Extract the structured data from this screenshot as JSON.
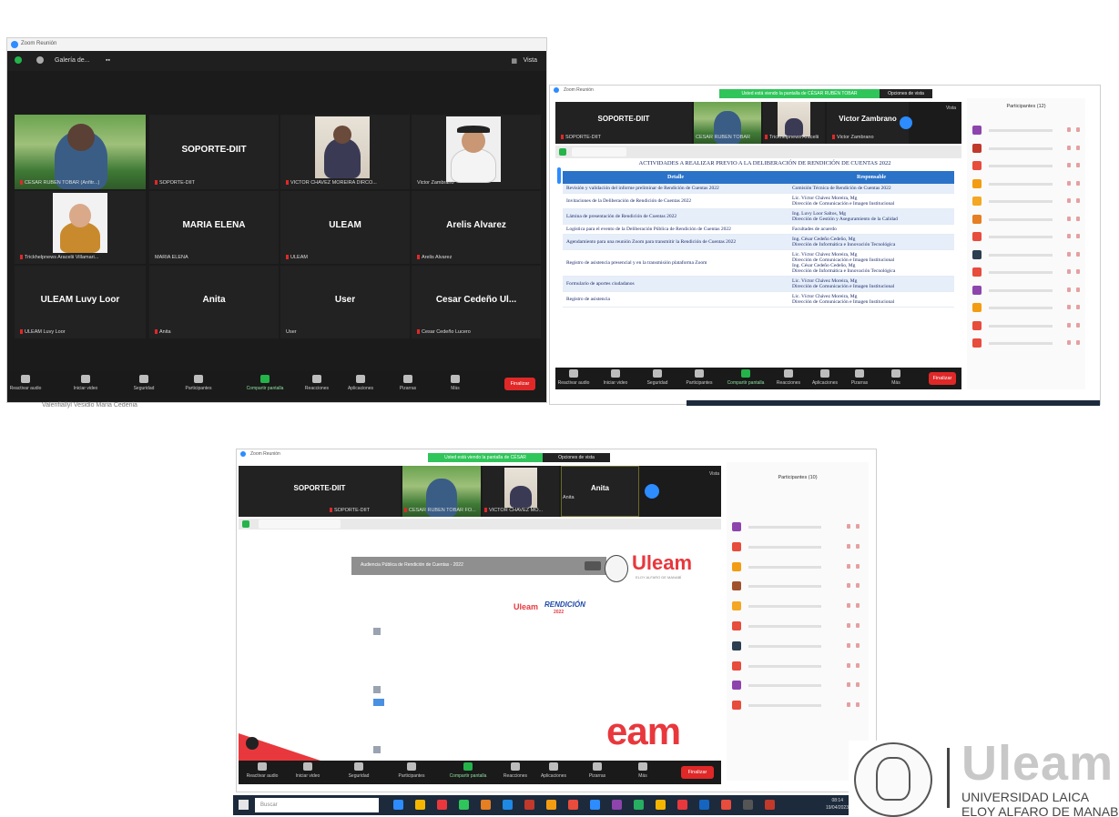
{
  "win1": {
    "title": "Zoom Reunión",
    "top_left_label": "Galería de...",
    "top_right_label": "Vista",
    "tiles": [
      {
        "name": "",
        "label": "CESAR RUBEN TOBAR (Anfitr...)"
      },
      {
        "name": "SOPORTE-DIIT",
        "label": "SOPORTE-DIIT"
      },
      {
        "name": "",
        "label": "VICTOR CHAVEZ MOREIRA DIRCO..."
      },
      {
        "name": "",
        "label": "Victor Zambrano"
      },
      {
        "name": "",
        "label": "Trickhelpnews Aracelii Villamari..."
      },
      {
        "name": "MARIA ELENA",
        "label": "MARIA ELENA"
      },
      {
        "name": "ULEAM",
        "label": "ULEAM"
      },
      {
        "name": "Arelis Alvarez",
        "label": "Arelis Alvarez"
      },
      {
        "name": "ULEAM Luvy Loor",
        "label": "ULEAM Luvy Loor"
      },
      {
        "name": "Anita",
        "label": "Anita"
      },
      {
        "name": "User",
        "label": "User"
      },
      {
        "name": "Cesar Cedeño Ul...",
        "label": "Cesar Cedeño Lucero"
      }
    ],
    "toolbar": [
      "Reactivar audio",
      "Iniciar video",
      "Seguridad",
      "Participantes",
      "Compartir pantalla",
      "Reacciones",
      "Aplicaciones",
      "Pizarras",
      "Más"
    ],
    "end_label": "Finalizar",
    "below_text": "Valenfiallyl Vesidlo Maria Cedenia"
  },
  "win2": {
    "title": "Zoom Reunión",
    "banner": "Usted está viendo la pantalla de CÉSAR RUBÉN TOBAR",
    "view_options": "Opciones de vista",
    "strip": [
      {
        "name": "SOPORTE-DIIT",
        "label": "SOPORTE-DIIT"
      },
      {
        "name": "",
        "label": "CESAR RUBEN TOBAR"
      },
      {
        "name": "",
        "label": "Trickhelpnews Aracelii"
      },
      {
        "name": "Victor Zambrano",
        "label": "Victor Zambrano"
      }
    ],
    "strip_view": "Vista",
    "doc_heading": "ACTIVIDADES A REALIZAR PREVIO A LA DELIBERACIÓN DE RENDICIÓN DE CUENTAS 2022",
    "table": {
      "headers": [
        "Detalle",
        "Responsable"
      ],
      "rows": [
        [
          "Revisión y validación del informe preliminar de Rendición de Cuentas 2022",
          "Comisión Técnica de Rendición de Cuentas 2022"
        ],
        [
          "Invitaciones de la Deliberación de Rendición de Cuentas 2022",
          "Lic. Víctor Chávez Moreira, Mg\nDirección de Comunicación e Imagen Institucional"
        ],
        [
          "Lámina de presentación de Rendición de Cuentas 2022",
          "Ing. Luvy Loor Saltos, Mg\nDirección de Gestión y Aseguramiento de la Calidad"
        ],
        [
          "Logística para el evento de la Deliberación Pública de Rendición de Cuentas 2022",
          "Facultades de acuerdo"
        ],
        [
          "Agendamiento para una reunión Zoom para transmitir la Rendición de Cuentas 2022",
          "Ing. César Cedeño Cedeño, Mg\nDirección de Informática e Innovación Tecnológica"
        ],
        [
          "Registro de asistencia presencial y en la transmisión plataforma Zoom",
          "Lic. Víctor Chávez Moreira, Mg\nDirección de Comunicación e Imagen Institucional\nIng. César Cedeño Cedeño, Mg\nDirección de Informática e Innovación Tecnológica"
        ],
        [
          "Formulario de aportes ciudadanos",
          "Lic. Víctor Chávez Moreira, Mg\nDirección de Comunicación e Imagen Institucional"
        ],
        [
          "Registro de asistencia",
          "Lic. Víctor Chávez Moreira, Mg\nDirección de Comunicación e Imagen Institucional"
        ]
      ]
    },
    "participants_title": "Participantes (12)",
    "toolbar": [
      "Reactivar audio",
      "Iniciar video",
      "Seguridad",
      "Participantes",
      "Compartir pantalla",
      "Reacciones",
      "Aplicaciones",
      "Pizarras",
      "Más"
    ],
    "end_label": "Finalizar"
  },
  "win3": {
    "title": "Zoom Reunión",
    "banner": "Usted está viendo la pantalla de CÉSAR",
    "view_options": "Opciones de vista",
    "strip": [
      {
        "name": "SOPORTE-DIIT",
        "label": "SOPORTE-DIIT"
      },
      {
        "name": "",
        "label": "CESAR RUBEN TOBAR FO..."
      },
      {
        "name": "",
        "label": "VICTOR CHAVEZ MO..."
      },
      {
        "name": "Anita",
        "label": "Anita"
      }
    ],
    "strip_view": "Vista",
    "page_title_bar": "Audiencia Pública de Rendición de Cuentas - 2022",
    "logo_text": "Uleam",
    "logo_sub": "ELOY ALFARO DE MANABÍ",
    "small_logo": "Uleam",
    "rendicion": "RENDICIÓN",
    "rendicion_sub": "2022",
    "big_text": "eam",
    "participants_title": "Participantes (10)",
    "toolbar": [
      "Reactivar audio",
      "Iniciar video",
      "Seguridad",
      "Participantes",
      "Compartir pantalla",
      "Reacciones",
      "Aplicaciones",
      "Pizarras",
      "Más"
    ],
    "end_label": "Finalizar"
  },
  "taskbar": {
    "search": "Buscar",
    "time": "08:14",
    "date": "19/04/2023"
  },
  "brand": {
    "name": "Uleam",
    "line1": "UNIVERSIDAD LAICA",
    "line2": "ELOY ALFARO DE MANABÍ",
    "color": "#c8c8c8"
  },
  "colors": {
    "zoom_blue": "#2d8cff",
    "share_green": "#24b44a",
    "end_red": "#e02828",
    "table_header": "#2a73c9",
    "uleam_red": "#e8383d"
  }
}
